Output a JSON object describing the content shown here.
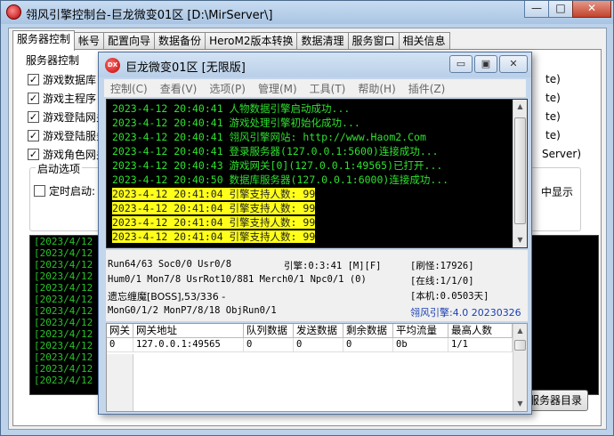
{
  "main_window": {
    "title": "翎风引擎控制台-巨龙微变01区 [D:\\MirServer\\]",
    "caption_buttons": {
      "minimize": "—",
      "maximize": "□",
      "close": "✕"
    },
    "tabs": [
      "服务器控制",
      "帐号",
      "配置向导",
      "数据备份",
      "HeroM2版本转换",
      "数据清理",
      "服务窗口",
      "相关信息"
    ],
    "active_tab": "服务器控制",
    "group_label": "服务器控制",
    "checkboxes": [
      {
        "label": "游戏数据库",
        "checked": true
      },
      {
        "label": "游戏主程序",
        "checked": true
      },
      {
        "label": "游戏登陆网关",
        "checked": true
      },
      {
        "label": "游戏登陆服务",
        "checked": true
      },
      {
        "label": "游戏角色网关",
        "checked": true
      }
    ],
    "right_fragments": [
      "te)",
      "te)",
      "te)",
      "te)",
      "Server)"
    ],
    "launch_group": {
      "label": "启动选项",
      "timer_checkbox": {
        "label": "定时启动:",
        "checked": false
      },
      "right_text": "中显示"
    },
    "console_lines": [
      "[2023/4/12 20",
      "[2023/4/12 20",
      "[2023/4/12 20",
      "[2023/4/12 20",
      "[2023/4/12 20",
      "[2023/4/12 20",
      "[2023/4/12 20",
      "[2023/4/12 20",
      "[2023/4/12 20",
      "[2023/4/12 20",
      "[2023/4/12 20",
      "[2023/4/12 20",
      "[2023/4/12 20"
    ],
    "server_dir_button": "服务器目录"
  },
  "child_window": {
    "title": "巨龙微变01区 [无限版]",
    "icon_text": "DX",
    "caption_buttons": {
      "minimize": "▭",
      "maximize": "▣",
      "close": "✕"
    },
    "menu": [
      "控制(C)",
      "查看(V)",
      "选项(P)",
      "管理(M)",
      "工具(T)",
      "帮助(H)",
      "插件(Z)"
    ],
    "log_lines": [
      {
        "text": "2023-4-12 20:40:41 人物数据引擎启动成功...",
        "highlight": false
      },
      {
        "text": "2023-4-12 20:40:41 游戏处理引擎初始化成功...",
        "highlight": false
      },
      {
        "text": "2023-4-12 20:40:41 翎风引擎网站: http://www.Haom2.Com",
        "highlight": false
      },
      {
        "text": "2023-4-12 20:40:41 登录服务器(127.0.0.1:5600)连接成功...",
        "highlight": false
      },
      {
        "text": "2023-4-12 20:40:43 游戏网关[0](127.0.0.1:49565)已打开...",
        "highlight": false
      },
      {
        "text": "2023-4-12 20:40:50 数据库服务器(127.0.0.1:6000)连接成功...",
        "highlight": false
      },
      {
        "text": "2023-4-12 20:41:04 引擎支持人数: 99",
        "highlight": true
      },
      {
        "text": "2023-4-12 20:41:04 引擎支持人数: 99",
        "highlight": true
      },
      {
        "text": "2023-4-12 20:41:04 引擎支持人数: 99",
        "highlight": true
      },
      {
        "text": "2023-4-12 20:41:04 引擎支持人数: 99",
        "highlight": true
      }
    ],
    "status": {
      "line1": "Run64/63 Soc0/0 Usr0/8",
      "engine": "引擎:0:3:41 [M][F]",
      "refresh": "[刷怪:17926]",
      "line2": "Hum0/1 Mon7/8 UsrRot10/881 Merch0/1 Npc0/1 (0)",
      "online": "[在线:1/1/0]",
      "line3": "遗忘缠魔[BOSS],53/336 -",
      "local": "[本机:0.0503天]",
      "line4": "MonG0/1/2 MonP7/8/18 ObjRun0/1",
      "version": "翎风引擎:4.0 20230326",
      "version_color": "#1a3fb0"
    },
    "gate_table": {
      "headers": [
        "网关",
        "网关地址",
        "队列数据",
        "发送数据",
        "剩余数据",
        "平均流量",
        "最高人数"
      ],
      "rows": [
        [
          "0",
          "127.0.0.1:49565",
          "0",
          "0",
          "0",
          "0b",
          "1/1"
        ]
      ]
    }
  }
}
